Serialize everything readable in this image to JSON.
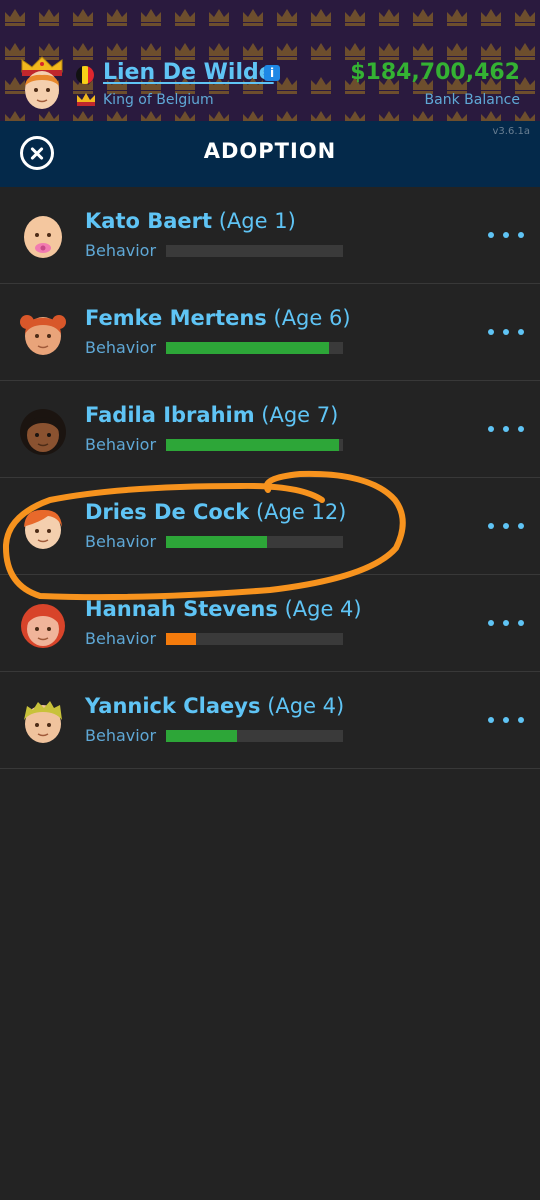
{
  "header": {
    "player_name": "Lien De Wilde",
    "player_title": "King of Belgium",
    "bank_amount": "$184,700,462",
    "bank_label": "Bank Balance",
    "info_icon": "i",
    "version": "v3.6.1a"
  },
  "title_bar": {
    "title": "ADOPTION"
  },
  "colors": {
    "accent_blue": "#5fc4f5",
    "money_green": "#34b233",
    "bar_green": "#2da638",
    "bar_orange": "#f47b0c",
    "annotation_orange": "#f7931e"
  },
  "children": [
    {
      "name": "Kato Baert",
      "age": "(Age 1)",
      "behavior_label": "Behavior",
      "behavior": 0.0,
      "bar_color": "#2da638",
      "avatar": "baby-avatar-icon"
    },
    {
      "name": "Femke Mertens",
      "age": "(Age 6)",
      "behavior_label": "Behavior",
      "behavior": 0.92,
      "bar_color": "#2da638",
      "avatar": "redhead-girl-avatar-icon"
    },
    {
      "name": "Fadila Ibrahim",
      "age": "(Age 7)",
      "behavior_label": "Behavior",
      "behavior": 0.98,
      "bar_color": "#2da638",
      "avatar": "dark-hair-girl-avatar-icon"
    },
    {
      "name": "Dries De Cock",
      "age": "(Age 12)",
      "behavior_label": "Behavior",
      "behavior": 0.57,
      "bar_color": "#2da638",
      "avatar": "redhead-boy-avatar-icon"
    },
    {
      "name": "Hannah Stevens",
      "age": "(Age 4)",
      "behavior_label": "Behavior",
      "behavior": 0.17,
      "bar_color": "#f47b0c",
      "avatar": "redhead-girl-avatar-icon"
    },
    {
      "name": "Yannick Claeys",
      "age": "(Age 4)",
      "behavior_label": "Behavior",
      "behavior": 0.4,
      "bar_color": "#2da638",
      "avatar": "blond-boy-avatar-icon"
    }
  ]
}
